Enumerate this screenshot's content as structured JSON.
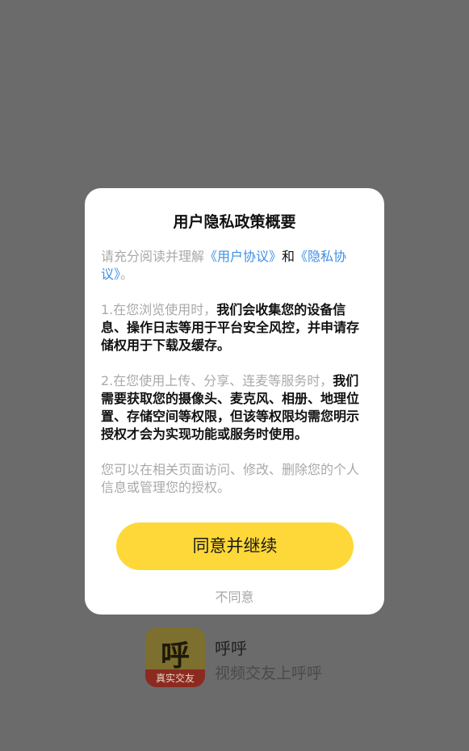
{
  "app": {
    "icon_glyph": "呼",
    "icon_ribbon": "真实交友",
    "name": "呼呼",
    "slogan": "视频交友上呼呼"
  },
  "dialog": {
    "title": "用户隐私政策概要",
    "intro": {
      "prefix": "请充分阅读并理解",
      "user_agreement_link": "《用户协议》",
      "and": "和",
      "privacy_link": "《隐私协议》",
      "suffix": "。"
    },
    "item1": {
      "plain": "1.在您浏览使用时，",
      "bold": "我们会收集您的设备信息、操作日志等用于平台安全风控，并申请存储权用于下载及缓存。"
    },
    "item2": {
      "plain": "2.在您使用上传、分享、连麦等服务时，",
      "bold": "我们需要获取您的摄像头、麦克风、相册、地理位置、存储空间等权限，但该等权限均需您明示授权才会为实现功能或服务时使用。"
    },
    "closing": "您可以在相关页面访问、修改、删除您的个人信息或管理您的授权。",
    "agree_label": "同意并继续",
    "disagree_label": "不同意"
  },
  "colors": {
    "overlay": "#6b6b6b",
    "accent_button": "#fdd838",
    "link": "#3e8fe6",
    "muted_text": "#a9a9a9"
  }
}
